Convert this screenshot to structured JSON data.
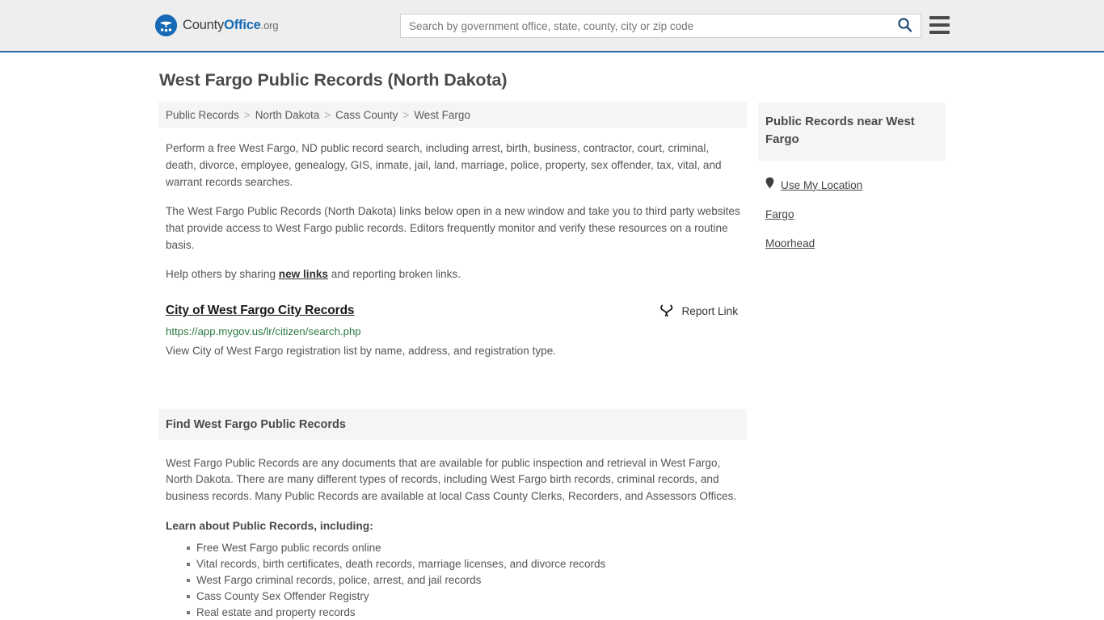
{
  "header": {
    "logo": {
      "part1": "County",
      "part2": "Office",
      "part3": ".org",
      "icon": "countyoffice-logo-icon"
    },
    "search": {
      "placeholder": "Search by government office, state, county, city or zip code",
      "value": "",
      "icon": "search-icon"
    },
    "menu_icon": "hamburger-menu-icon",
    "accent_color": "#1669b4",
    "border_color": "#2a6aa5"
  },
  "page": {
    "title": "West Fargo Public Records (North Dakota)"
  },
  "breadcrumb": {
    "items": [
      {
        "label": "Public Records",
        "is_link": true
      },
      {
        "label": "North Dakota",
        "is_link": true
      },
      {
        "label": "Cass County",
        "is_link": true
      },
      {
        "label": "West Fargo",
        "is_link": false
      }
    ],
    "separator": ">"
  },
  "intro": {
    "paragraph1": "Perform a free West Fargo, ND public record search, including arrest, birth, business, contractor, court, criminal, death, divorce, employee, genealogy, GIS, inmate, jail, land, marriage, police, property, sex offender, tax, vital, and warrant records searches.",
    "paragraph2": "The West Fargo Public Records (North Dakota) links below open in a new window and take you to third party websites that provide access to West Fargo public records. Editors frequently monitor and verify these resources on a routine basis.",
    "paragraph3_before": "Help others by sharing ",
    "paragraph3_link": "new links",
    "paragraph3_after": " and reporting broken links."
  },
  "result": {
    "title": "City of West Fargo City Records",
    "url": "https://app.mygov.us/lr/citizen/search.php",
    "description": "View City of West Fargo registration list by name, address, and registration type.",
    "report_label": "Report Link",
    "report_icon": "broken-link-icon",
    "url_color": "#2c7a3f"
  },
  "section": {
    "heading": "Find West Fargo Public Records",
    "paragraph": "West Fargo Public Records are any documents that are available for public inspection and retrieval in West Fargo, North Dakota. There are many different types of records, including West Fargo birth records, criminal records, and business records. Many Public Records are available at local Cass County Clerks, Recorders, and Assessors Offices.",
    "learn_heading": "Learn about Public Records, including:",
    "bullets": [
      "Free West Fargo public records online",
      "Vital records, birth certificates, death records, marriage licenses, and divorce records",
      "West Fargo criminal records, police, arrest, and jail records",
      "Cass County Sex Offender Registry",
      "Real estate and property records"
    ]
  },
  "aside": {
    "heading": "Public Records near West Fargo",
    "links": [
      {
        "label": "Use My Location",
        "icon": "map-pin-icon"
      },
      {
        "label": "Fargo",
        "icon": null
      },
      {
        "label": "Moorhead",
        "icon": null
      }
    ]
  }
}
